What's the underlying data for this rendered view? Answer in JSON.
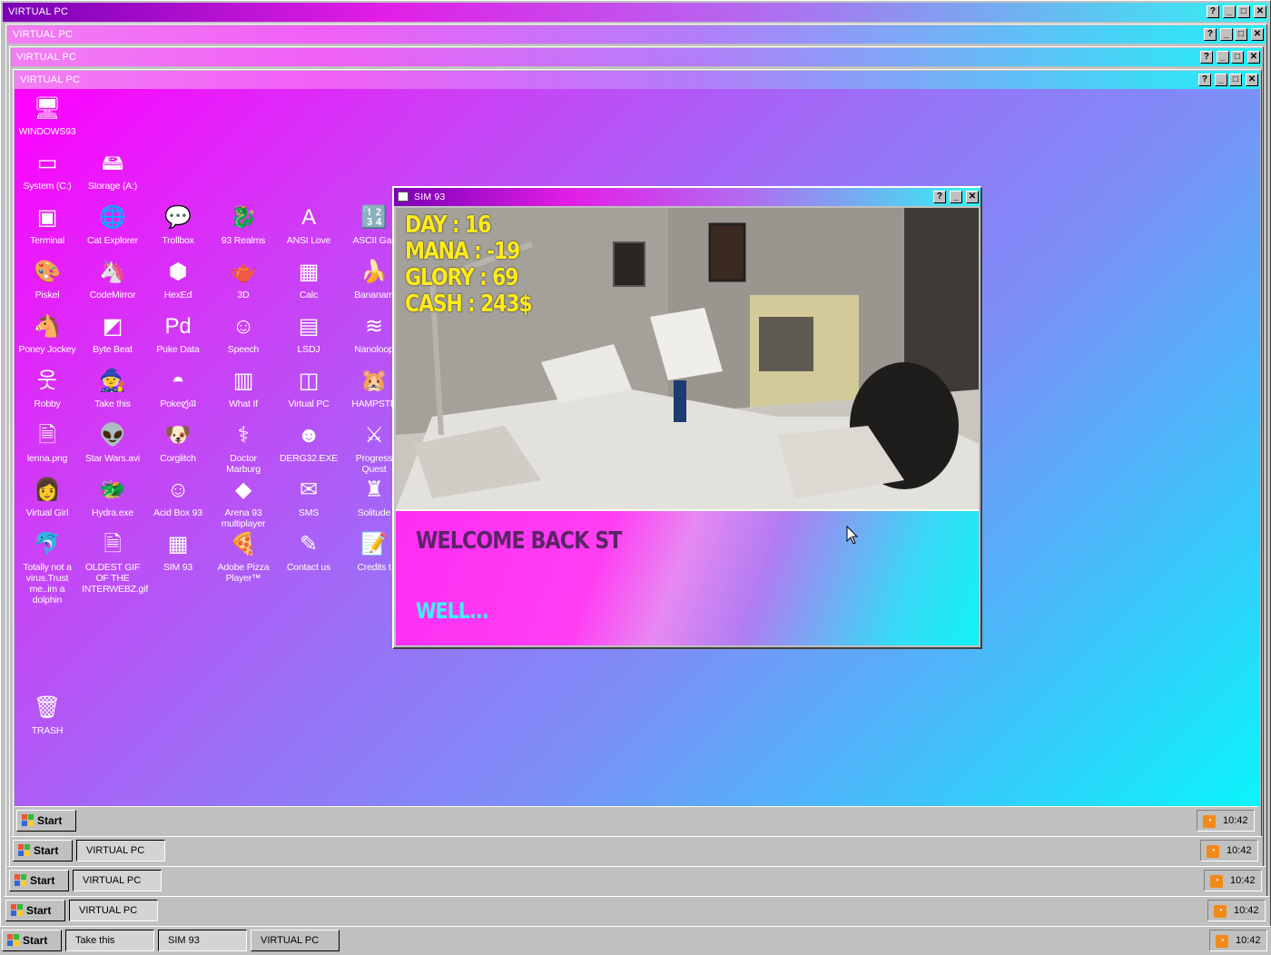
{
  "windows": [
    {
      "title": "VIRTUAL PC"
    },
    {
      "title": "VIRTUAL PC"
    },
    {
      "title": "VIRTUAL PC"
    },
    {
      "title": "VIRTUAL PC"
    }
  ],
  "window_buttons": {
    "help": "?",
    "minimize": "_",
    "maximize": "□",
    "close": "✕"
  },
  "desktop_icons": [
    {
      "label": "WINDOWS93",
      "icon": "computer-icon"
    },
    {
      "label": "System (C:)",
      "icon": "drive-icon"
    },
    {
      "label": "Storage (A:)",
      "icon": "floppy-drive-icon"
    },
    {
      "label": "Terminal",
      "icon": "terminal-icon"
    },
    {
      "label": "Cat Explorer",
      "icon": "globe-icon"
    },
    {
      "label": "Trollbox",
      "icon": "chat-icon"
    },
    {
      "label": "93 Realms",
      "icon": "dragon-icon"
    },
    {
      "label": "ANSI Love",
      "icon": "ansi-icon"
    },
    {
      "label": "ASCII Gall",
      "icon": "numbers-icon"
    },
    {
      "label": "Piskel",
      "icon": "palette-icon"
    },
    {
      "label": "CodeMirror",
      "icon": "unicorn-icon"
    },
    {
      "label": "HexEd",
      "icon": "cube-icon"
    },
    {
      "label": "3D",
      "icon": "teapot-icon"
    },
    {
      "label": "Calc",
      "icon": "calculator-icon"
    },
    {
      "label": "Bananam",
      "icon": "banana-icon"
    },
    {
      "label": "Poney Jockey",
      "icon": "pony-icon"
    },
    {
      "label": "Byte Beat",
      "icon": "bytebeat-icon"
    },
    {
      "label": "Puke Data",
      "icon": "pd-icon"
    },
    {
      "label": "Speech",
      "icon": "face-icon"
    },
    {
      "label": "LSDJ",
      "icon": "gameboy-icon"
    },
    {
      "label": "Nanoloop",
      "icon": "wave-icon"
    },
    {
      "label": "Robby",
      "icon": "stick-figure-icon"
    },
    {
      "label": "Take this",
      "icon": "old-man-icon"
    },
    {
      "label": "Pokeღ̸̡ıʇʇ",
      "icon": "pokeball-icon"
    },
    {
      "label": "What If",
      "icon": "barcode-icon"
    },
    {
      "label": "Virtual PC",
      "icon": "window-icon"
    },
    {
      "label": "HAMPSTE",
      "icon": "hamster-icon"
    },
    {
      "label": "lenna.png",
      "icon": "image-file-icon"
    },
    {
      "label": "Star Wars.avi",
      "icon": "yoda-icon"
    },
    {
      "label": "Corglitch",
      "icon": "corgi-icon"
    },
    {
      "label": "Doctor Marburg",
      "icon": "doctor-icon"
    },
    {
      "label": "DERG32.EXE",
      "icon": "monitor-face-icon"
    },
    {
      "label": "Progress Quest",
      "icon": "crossed-swords-icon"
    },
    {
      "label": "Virtual Girl",
      "icon": "girl-icon"
    },
    {
      "label": "Hydra.exe",
      "icon": "hydra-icon"
    },
    {
      "label": "Acid Box 93",
      "icon": "smiley-icon"
    },
    {
      "label": "Arena 93 multiplayer",
      "icon": "cube-color-icon"
    },
    {
      "label": "SMS",
      "icon": "sms-icon"
    },
    {
      "label": "Solitude",
      "icon": "solitude-icon"
    },
    {
      "label": "Totally not a virus.Trust me..im a dolphin",
      "icon": "dolphin-icon"
    },
    {
      "label": "OLDEST GIF OF THE INTERWEBZ.gif",
      "icon": "gif-file-icon"
    },
    {
      "label": "SIM 93",
      "icon": "sim-icon"
    },
    {
      "label": "Adobe Pizza Player™",
      "icon": "pizza-icon"
    },
    {
      "label": "Contact us",
      "icon": "contact-icon"
    },
    {
      "label": "Credits t",
      "icon": "notepad-icon"
    },
    {
      "label": "TRASH",
      "icon": "trash-icon"
    }
  ],
  "sim_window": {
    "title": "SIM 93",
    "stats": {
      "day": "DAY : 16",
      "mana": "MANA : -19",
      "glory": "GLORY : 69",
      "cash": "CASH : 243$"
    },
    "message": "WELCOME BACK ST",
    "reply": "WELL..."
  },
  "taskbars": [
    {
      "start": "Start",
      "items": [],
      "clock": "10:42"
    },
    {
      "start": "Start",
      "items": [
        "VIRTUAL PC"
      ],
      "clock": "10:42"
    },
    {
      "start": "Start",
      "items": [
        "VIRTUAL PC"
      ],
      "clock": "10:42"
    },
    {
      "start": "Start",
      "items": [
        "VIRTUAL PC"
      ],
      "clock": "10:42"
    },
    {
      "start": "Start",
      "items": [
        "Take this",
        "SIM 93",
        "VIRTUAL PC"
      ],
      "clock": "10:42"
    }
  ],
  "colors": {
    "stats_yellow": "#ffea1a",
    "desktop_magenta": "#ff00ff",
    "desktop_cyan": "#0af5fb",
    "chrome_gray": "#c0c0c0"
  }
}
